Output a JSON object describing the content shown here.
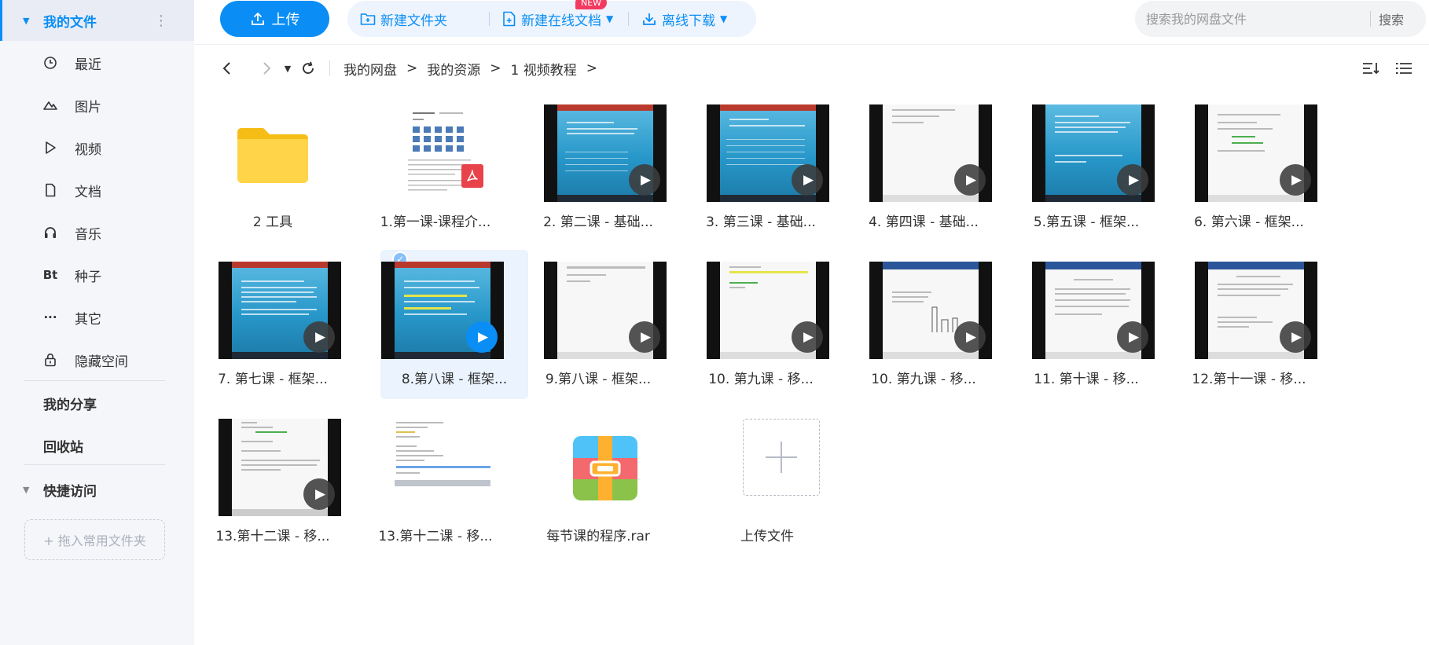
{
  "sidebar": {
    "my_files": "我的文件",
    "more_glyph": "⋮",
    "items": [
      {
        "label": "最近",
        "icon": "clock-icon"
      },
      {
        "label": "图片",
        "icon": "image-icon"
      },
      {
        "label": "视频",
        "icon": "video-icon"
      },
      {
        "label": "文档",
        "icon": "document-icon"
      },
      {
        "label": "音乐",
        "icon": "headphones-icon"
      },
      {
        "label": "种子",
        "icon": "bt-icon",
        "glyph": "Bt"
      },
      {
        "label": "其它",
        "icon": "more-dots-icon",
        "glyph": "···"
      },
      {
        "label": "隐藏空间",
        "icon": "lock-icon"
      }
    ],
    "my_share": "我的分享",
    "recycle_bin": "回收站",
    "quick_access": "快捷访问",
    "drop_hint": "+ 拖入常用文件夹"
  },
  "toolbar": {
    "upload": "上传",
    "new_folder": "新建文件夹",
    "new_online_doc": "新建在线文档",
    "new_badge": "NEW",
    "offline_download": "离线下载",
    "search_placeholder": "搜索我的网盘文件",
    "search_button": "搜索"
  },
  "breadcrumb": [
    "我的网盘",
    "我的资源",
    "1 视频教程"
  ],
  "breadcrumb_sep": ">",
  "files": [
    {
      "name": "2 工具",
      "type": "folder"
    },
    {
      "name": "1.第一课-课程介...",
      "type": "pdf"
    },
    {
      "name": "2. 第二课 - 基础...",
      "type": "video",
      "style": "blue"
    },
    {
      "name": "3. 第三课 - 基础...",
      "type": "video",
      "style": "blue"
    },
    {
      "name": "4. 第四课 - 基础...",
      "type": "video",
      "style": "white"
    },
    {
      "name": "5.第五课 - 框架...",
      "type": "video",
      "style": "blue"
    },
    {
      "name": "6. 第六课 - 框架...",
      "type": "video",
      "style": "white"
    },
    {
      "name": "7. 第七课 - 框架...",
      "type": "video",
      "style": "blue"
    },
    {
      "name": "8.第八课 - 框架...",
      "type": "video",
      "style": "blue",
      "selected": true
    },
    {
      "name": "9.第八课 - 框架...",
      "type": "video",
      "style": "white"
    },
    {
      "name": "10. 第九课 - 移...",
      "type": "video",
      "style": "white"
    },
    {
      "name": "10. 第九课 - 移...",
      "type": "video",
      "style": "word"
    },
    {
      "name": "11. 第十课 - 移...",
      "type": "video",
      "style": "word"
    },
    {
      "name": "12.第十一课 - 移...",
      "type": "video",
      "style": "word"
    },
    {
      "name": "13.第十二课 - 移...",
      "type": "video",
      "style": "white"
    },
    {
      "name": "13.第十二课 - 移...",
      "type": "image"
    },
    {
      "name": "每节课的程序.rar",
      "type": "rar"
    },
    {
      "name": "上传文件",
      "type": "upload"
    }
  ],
  "colors": {
    "accent": "#0a8ef5",
    "badge": "#f23a5f",
    "folder": "#ffd448"
  }
}
